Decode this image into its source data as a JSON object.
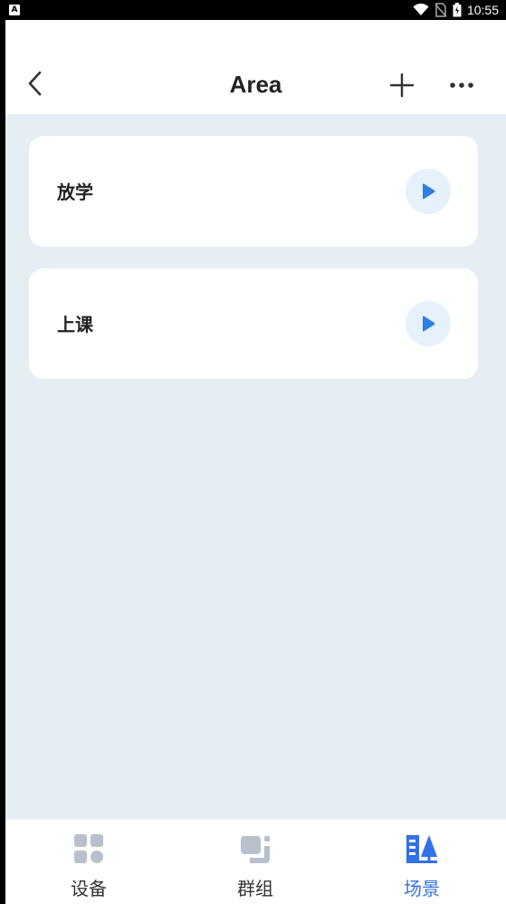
{
  "status_bar": {
    "time": "10:55",
    "notification_icon": "A"
  },
  "header": {
    "title": "Area",
    "back_icon": "chevron-left-icon",
    "add_icon": "plus-icon",
    "more_icon": "more-horizontal-icon"
  },
  "scenes": [
    {
      "name": "放学",
      "action_icon": "play-icon"
    },
    {
      "name": "上课",
      "action_icon": "play-icon"
    }
  ],
  "tabs": [
    {
      "label": "设备",
      "icon": "devices-grid-icon",
      "active": false
    },
    {
      "label": "群组",
      "icon": "group-icon",
      "active": false
    },
    {
      "label": "场景",
      "icon": "scene-icon",
      "active": true
    }
  ],
  "colors": {
    "accent": "#3370e8",
    "play": "#2e7ee6",
    "background": "#e5eef3",
    "inactive_icon": "#b7c0cc"
  }
}
